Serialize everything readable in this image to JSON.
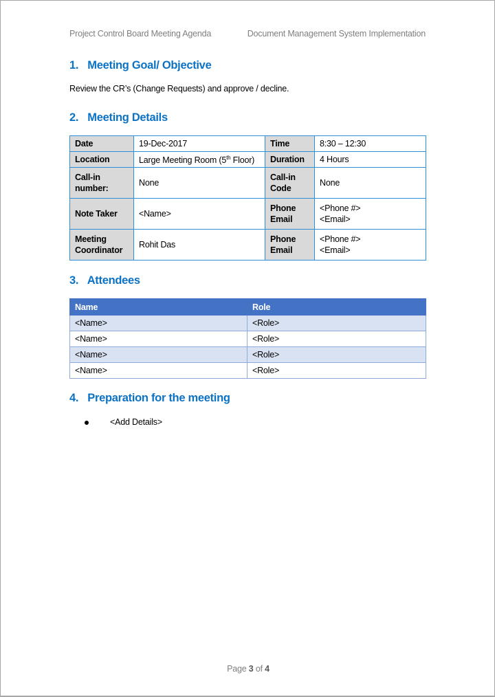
{
  "header": {
    "left": "Project Control Board Meeting Agenda",
    "right": "Document Management System Implementation"
  },
  "sections": [
    {
      "num": "1.",
      "title": "Meeting Goal/ Objective"
    },
    {
      "num": "2.",
      "title": "Meeting Details"
    },
    {
      "num": "3.",
      "title": "Attendees"
    },
    {
      "num": "4.",
      "title": "Preparation for the meeting"
    }
  ],
  "objective_text": "Review the CR’s (Change Requests) and approve / decline.",
  "details": {
    "date_label": "Date",
    "date_value": "19-Dec-2017",
    "time_label": "Time",
    "time_value": "8:30 – 12:30",
    "location_label": "Location",
    "location_value_pre": "Large Meeting Room (5",
    "location_value_sup": "th",
    "location_value_post": " Floor)",
    "duration_label": "Duration",
    "duration_value": "4 Hours",
    "callin_number_label_1": "Call-in",
    "callin_number_label_2": "number:",
    "callin_number_value": "None",
    "callin_code_label_1": "Call-in",
    "callin_code_label_2": "Code",
    "callin_code_value": "None",
    "note_taker_label": "Note Taker",
    "note_taker_value": "<Name>",
    "phone_label": "Phone",
    "email_label": "Email",
    "note_taker_phone": "<Phone #>",
    "note_taker_email": "<Email>",
    "coordinator_label_1": "Meeting",
    "coordinator_label_2": "Coordinator",
    "coordinator_value": "Rohit Das",
    "coordinator_phone": "<Phone #>",
    "coordinator_email": "<Email>"
  },
  "attendees": {
    "headers": [
      "Name",
      "Role"
    ],
    "rows": [
      [
        "<Name>",
        "<Role>"
      ],
      [
        "<Name>",
        "<Role>"
      ],
      [
        "<Name>",
        "<Role>"
      ],
      [
        "<Name>",
        "<Role>"
      ]
    ]
  },
  "preparation": [
    "<Add Details>"
  ],
  "footer": {
    "prefix": "Page ",
    "current": "3",
    "mid": " of ",
    "total": "4"
  },
  "colors": {
    "heading": "#0b72c4",
    "table_border": "#2e8fd8",
    "label_bg": "#d9d9d9",
    "attendee_header": "#4472c4",
    "attendee_alt": "#d9e2f3"
  }
}
